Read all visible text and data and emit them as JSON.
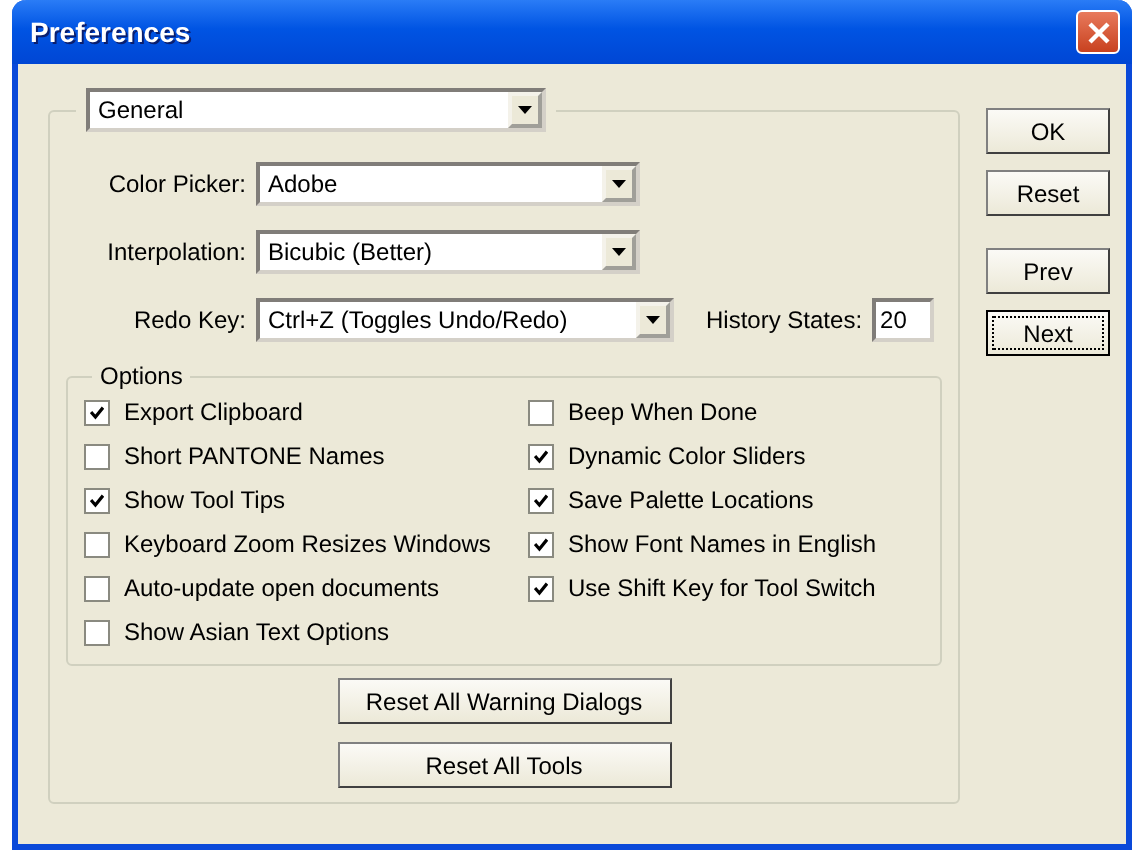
{
  "window": {
    "title": "Preferences"
  },
  "page_select": {
    "value": "General"
  },
  "fields": [
    {
      "label": "Color Picker:",
      "value": "Adobe"
    },
    {
      "label": "Interpolation:",
      "value": "Bicubic (Better)"
    },
    {
      "label": "Redo Key:",
      "value": "Ctrl+Z (Toggles Undo/Redo)"
    }
  ],
  "history_states": {
    "label": "History States:",
    "value": "20"
  },
  "options": {
    "title": "Options",
    "left_column": [
      {
        "label": "Export Clipboard",
        "checked": true
      },
      {
        "label": "Short PANTONE Names",
        "checked": false
      },
      {
        "label": "Show Tool Tips",
        "checked": true
      },
      {
        "label": "Keyboard Zoom Resizes Windows",
        "checked": false
      },
      {
        "label": "Auto-update open documents",
        "checked": false
      },
      {
        "label": "Show Asian Text Options",
        "checked": false
      }
    ],
    "right_column": [
      {
        "label": "Beep When Done",
        "checked": false
      },
      {
        "label": "Dynamic Color Sliders",
        "checked": true
      },
      {
        "label": "Save Palette Locations",
        "checked": true
      },
      {
        "label": "Show Font Names in English",
        "checked": true
      },
      {
        "label": "Use Shift Key for Tool Switch",
        "checked": true
      }
    ]
  },
  "reset_buttons": [
    "Reset All Warning Dialogs",
    "Reset All Tools"
  ],
  "side_buttons": [
    {
      "label": "OK",
      "focused": false
    },
    {
      "label": "Reset",
      "focused": false
    },
    {
      "label": "Prev",
      "focused": false
    },
    {
      "label": "Next",
      "focused": true
    }
  ]
}
